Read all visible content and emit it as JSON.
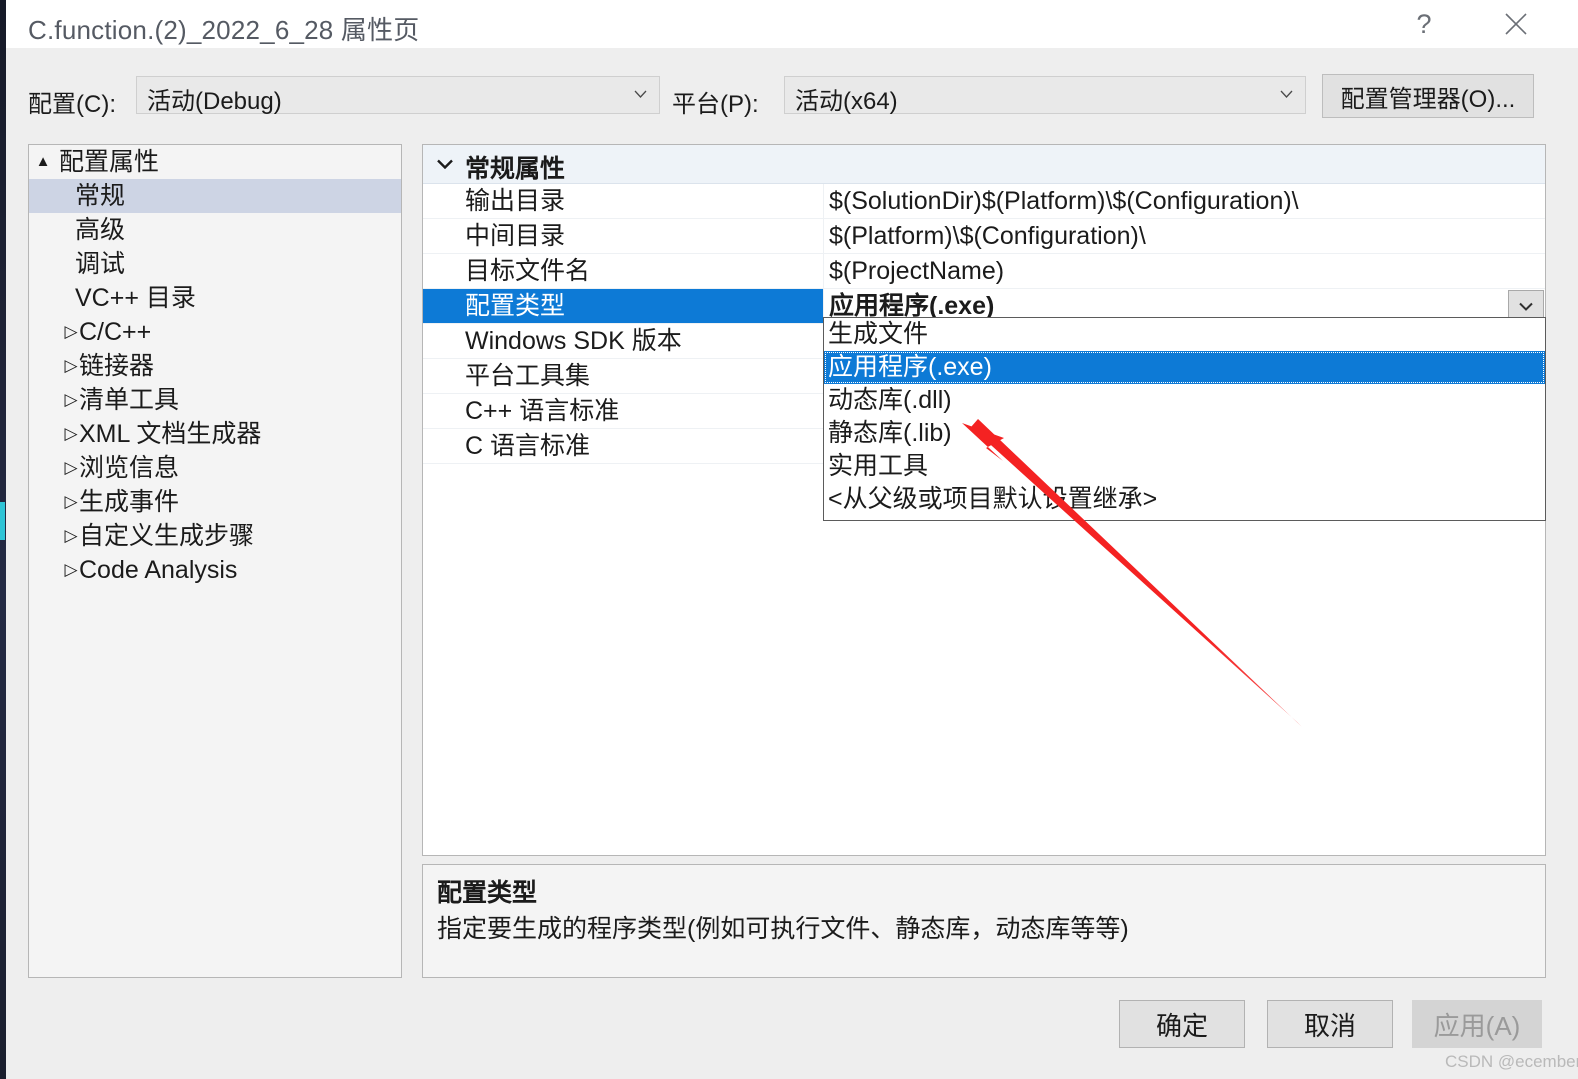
{
  "window": {
    "title": "C.function.(2)_2022_6_28 属性页",
    "help_glyph": "?",
    "close_glyph": "✕"
  },
  "toolbar": {
    "configuration_label": "配置(C):",
    "configuration_value": "活动(Debug)",
    "platform_label": "平台(P):",
    "platform_value": "活动(x64)",
    "config_manager_label": "配置管理器(O)..."
  },
  "tree": {
    "items": [
      {
        "label": "配置属性",
        "level": "root",
        "expander": "▲",
        "selected": false
      },
      {
        "label": "常规",
        "level": "leaf",
        "expander": "",
        "selected": true
      },
      {
        "label": "高级",
        "level": "leaf",
        "expander": "",
        "selected": false
      },
      {
        "label": "调试",
        "level": "leaf",
        "expander": "",
        "selected": false
      },
      {
        "label": "VC++ 目录",
        "level": "leaf",
        "expander": "",
        "selected": false
      },
      {
        "label": "C/C++",
        "level": "group",
        "expander": "▷",
        "selected": false
      },
      {
        "label": "链接器",
        "level": "group",
        "expander": "▷",
        "selected": false
      },
      {
        "label": "清单工具",
        "level": "group",
        "expander": "▷",
        "selected": false
      },
      {
        "label": "XML 文档生成器",
        "level": "group",
        "expander": "▷",
        "selected": false
      },
      {
        "label": "浏览信息",
        "level": "group",
        "expander": "▷",
        "selected": false
      },
      {
        "label": "生成事件",
        "level": "group",
        "expander": "▷",
        "selected": false
      },
      {
        "label": "自定义生成步骤",
        "level": "group",
        "expander": "▷",
        "selected": false
      },
      {
        "label": "Code Analysis",
        "level": "group",
        "expander": "▷",
        "selected": false
      }
    ]
  },
  "grid": {
    "section_title": "常规属性",
    "section_chevron": "⌄",
    "rows": [
      {
        "name": "输出目录",
        "value": "$(SolutionDir)$(Platform)\\$(Configuration)\\",
        "selected": false
      },
      {
        "name": "中间目录",
        "value": "$(Platform)\\$(Configuration)\\",
        "selected": false
      },
      {
        "name": "目标文件名",
        "value": "$(ProjectName)",
        "selected": false
      },
      {
        "name": "配置类型",
        "value": "应用程序(.exe)",
        "selected": true
      },
      {
        "name": "Windows SDK 版本",
        "value": "",
        "selected": false
      },
      {
        "name": "平台工具集",
        "value": "",
        "selected": false
      },
      {
        "name": "C++ 语言标准",
        "value": "",
        "selected": false
      },
      {
        "name": "C 语言标准",
        "value": "",
        "selected": false
      }
    ]
  },
  "dropdown": {
    "options": [
      {
        "label": "生成文件",
        "active": false
      },
      {
        "label": "应用程序(.exe)",
        "active": true
      },
      {
        "label": "动态库(.dll)",
        "active": false
      },
      {
        "label": "静态库(.lib)",
        "active": false
      },
      {
        "label": "实用工具",
        "active": false
      },
      {
        "label": "<从父级或项目默认设置继承>",
        "active": false
      }
    ]
  },
  "description": {
    "title": "配置类型",
    "body": "指定要生成的程序类型(例如可执行文件、静态库，动态库等等)"
  },
  "footer": {
    "ok_label": "确定",
    "cancel_label": "取消",
    "apply_label": "应用(A)"
  },
  "watermark": "CSDN @ecember",
  "colors": {
    "selection_blue": "#0d7ad6",
    "tree_selection": "#cdd4e4",
    "annotation_red": "#f42222",
    "dialog_bg": "#eeeeee"
  }
}
